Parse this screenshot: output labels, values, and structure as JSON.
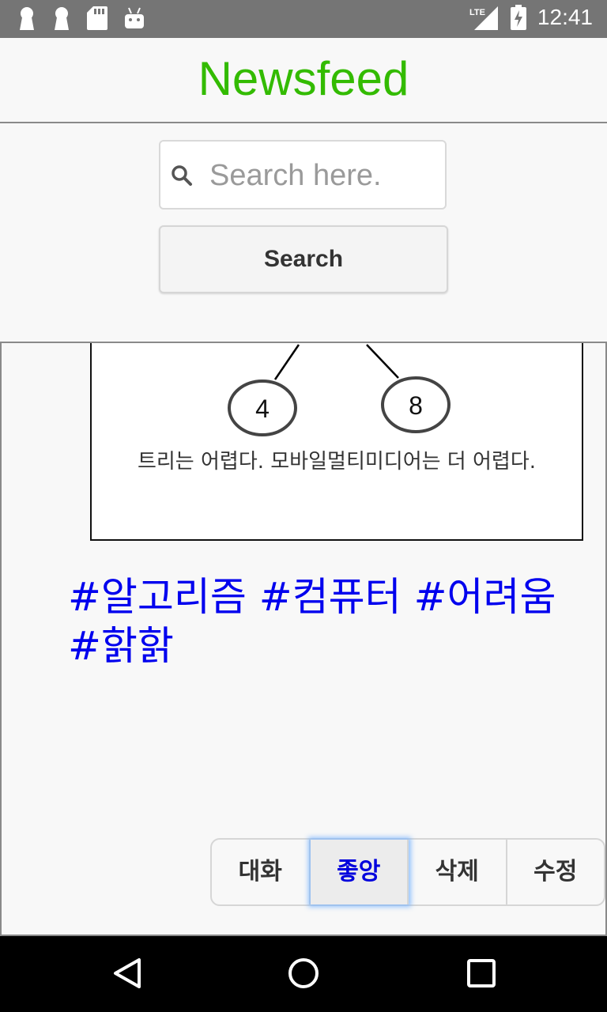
{
  "status_bar": {
    "time": "12:41",
    "network": "LTE",
    "icons": [
      "keyhole-icon",
      "keyhole-icon",
      "sd-card-icon",
      "android-icon",
      "lte-signal-icon",
      "battery-charging-icon"
    ]
  },
  "header": {
    "title": "Newsfeed"
  },
  "search": {
    "placeholder": "Search here.",
    "value": "",
    "button_label": "Search"
  },
  "post": {
    "image_nodes": [
      "4",
      "8"
    ],
    "text": "트리는 어렵다. 모바일멀티미디어는 더 어렵다.",
    "hashtags": "#알고리즘 #컴퓨터 #어려움 #핡핡"
  },
  "actions": [
    {
      "label": "대화",
      "active": false
    },
    {
      "label": "좋앙",
      "active": true
    },
    {
      "label": "삭제",
      "active": false
    },
    {
      "label": "수정",
      "active": false
    }
  ],
  "colors": {
    "title": "#33bb00",
    "hashtag": "#0000ee",
    "active_action": "#0000dd",
    "status_bar": "#757575",
    "nav_bar": "#000000"
  },
  "nav": [
    "back-icon",
    "home-icon",
    "recents-icon"
  ]
}
